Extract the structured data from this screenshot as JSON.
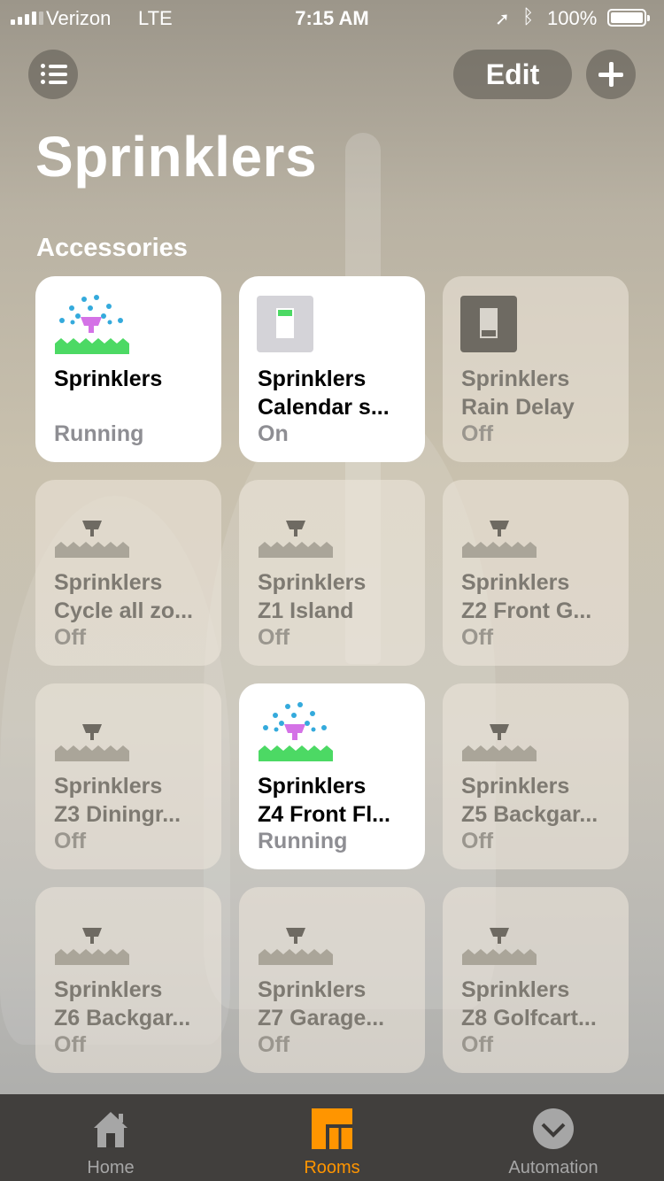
{
  "status_bar": {
    "carrier": "Verizon",
    "network": "LTE",
    "time": "7:15 AM",
    "battery": "100%"
  },
  "header": {
    "edit_label": "Edit",
    "title": "Sprinklers",
    "section": "Accessories"
  },
  "tiles": [
    {
      "line1": "Sprinklers",
      "line2": "",
      "status": "Running",
      "icon": "sprinkler-active-icon",
      "on": true
    },
    {
      "line1": "Sprinklers",
      "line2": "Calendar s...",
      "status": "On",
      "icon": "switch-on-icon",
      "on": true
    },
    {
      "line1": "Sprinklers",
      "line2": "Rain Delay",
      "status": "Off",
      "icon": "switch-off-icon",
      "on": false
    },
    {
      "line1": "Sprinklers",
      "line2": "Cycle all zo...",
      "status": "Off",
      "icon": "sprinkler-icon",
      "on": false
    },
    {
      "line1": "Sprinklers",
      "line2": "Z1 Island",
      "status": "Off",
      "icon": "sprinkler-icon",
      "on": false
    },
    {
      "line1": "Sprinklers",
      "line2": "Z2 Front G...",
      "status": "Off",
      "icon": "sprinkler-icon",
      "on": false
    },
    {
      "line1": "Sprinklers",
      "line2": "Z3 Diningr...",
      "status": "Off",
      "icon": "sprinkler-icon",
      "on": false
    },
    {
      "line1": "Sprinklers",
      "line2": "Z4 Front Fl...",
      "status": "Running",
      "icon": "sprinkler-active-icon",
      "on": true
    },
    {
      "line1": "Sprinklers",
      "line2": "Z5 Backgar...",
      "status": "Off",
      "icon": "sprinkler-icon",
      "on": false
    },
    {
      "line1": "Sprinklers",
      "line2": "Z6 Backgar...",
      "status": "Off",
      "icon": "sprinkler-icon",
      "on": false
    },
    {
      "line1": "Sprinklers",
      "line2": "Z7 Garage...",
      "status": "Off",
      "icon": "sprinkler-icon",
      "on": false
    },
    {
      "line1": "Sprinklers",
      "line2": "Z8 Golfcart...",
      "status": "Off",
      "icon": "sprinkler-icon",
      "on": false
    }
  ],
  "tab_bar": {
    "home": "Home",
    "rooms": "Rooms",
    "automation": "Automation",
    "active": "rooms"
  },
  "colors": {
    "accent": "#ff9500",
    "sprinkler_head_active": "#d472e6",
    "water_drop": "#34aadc",
    "grass": "#4cd964",
    "switch_on": "#4cd964"
  }
}
